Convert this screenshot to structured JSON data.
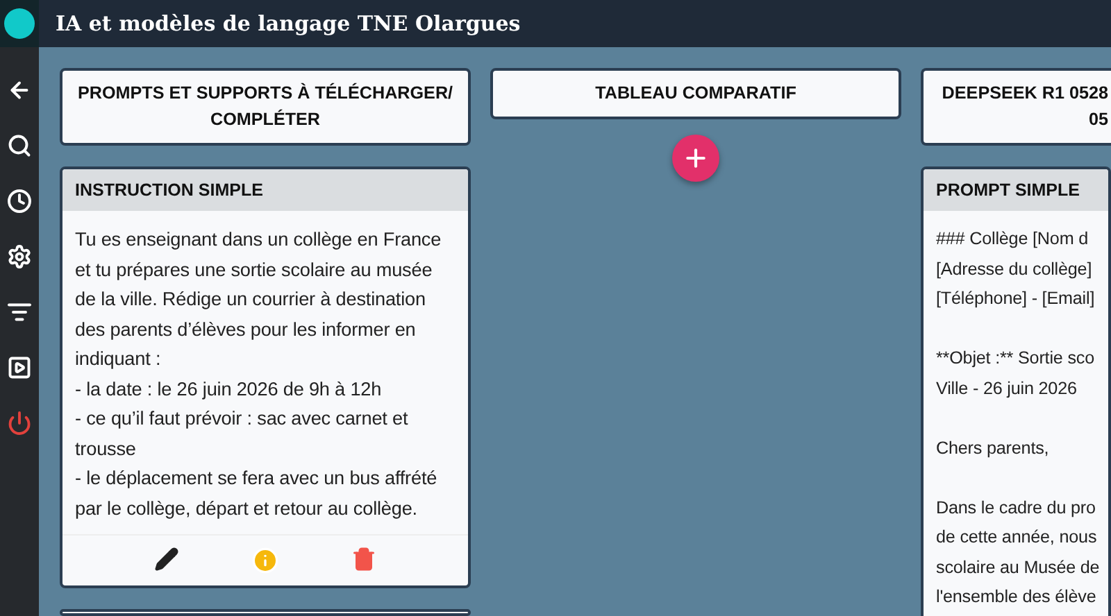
{
  "app_title": "IA et modèles de langage TNE Olargues",
  "sidebar": [
    {
      "kind": "back"
    },
    {
      "kind": "search"
    },
    {
      "kind": "history"
    },
    {
      "kind": "settings"
    },
    {
      "kind": "sort"
    },
    {
      "kind": "slideshow"
    },
    {
      "kind": "logout"
    }
  ],
  "columns": [
    {
      "title": "PROMPTS ET SUPPORTS À TÉLÉCHARGER/ COMPLÉTER",
      "cards": [
        {
          "title": "INSTRUCTION SIMPLE",
          "text": "Tu es enseignant dans un collège en France et tu prépares une sortie scolaire au musée de la ville. Rédige un courrier à destination des parents d’élèves pour les informer en indiquant :\n- la date : le 26 juin 2026 de 9h à 12h\n- ce qu’il faut prévoir : sac avec carnet et trousse\n- le déplacement se fera avec un bus affrété par le collège, départ et retour au collège.",
          "actions": true
        },
        {
          "kind": "partial"
        }
      ]
    },
    {
      "title": "TABLEAU COMPARATIF",
      "add_button": true
    },
    {
      "title": "DEEPSEEK R1 0528\n05",
      "cards": [
        {
          "title": "PROMPT SIMPLE",
          "text": "### Collège [Nom d\n[Adresse du collège]\n[Téléphone] - [Email]\n\n**Objet :** Sortie sco\nVille - 26 juin 2026\n\nChers parents,\n\nDans le cadre du pro\nde cette année, nous\nscolaire au Musée de\nl'ensemble des élève",
          "actions": false
        }
      ]
    }
  ]
}
